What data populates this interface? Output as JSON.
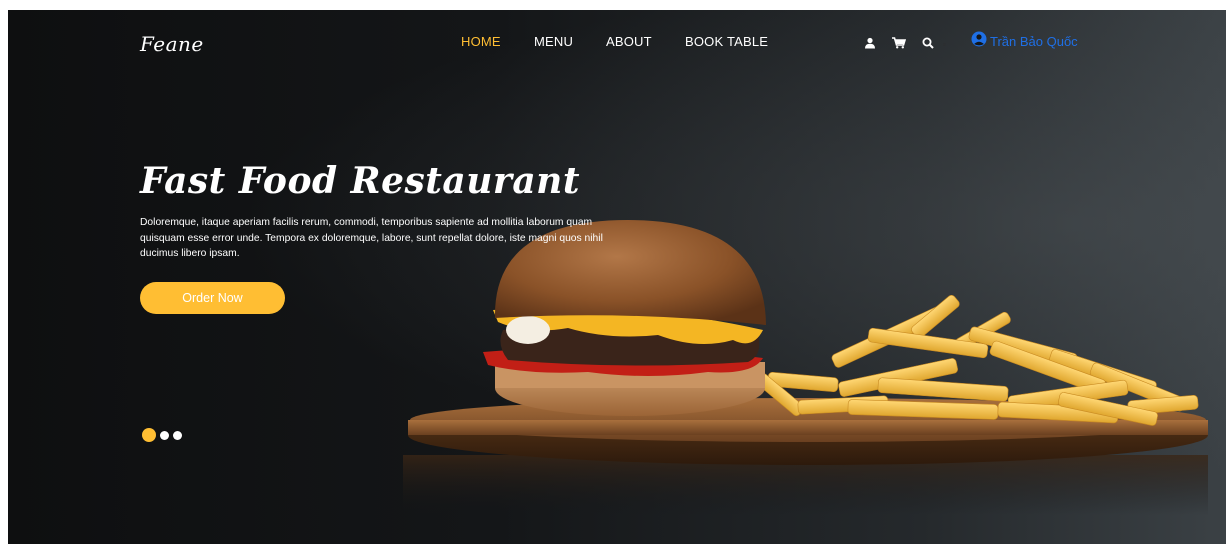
{
  "brand": {
    "logo": "Feane"
  },
  "nav": {
    "links": [
      {
        "label": "HOME",
        "active": true
      },
      {
        "label": "MENU",
        "active": false
      },
      {
        "label": "ABOUT",
        "active": false
      },
      {
        "label": "BOOK TABLE",
        "active": false
      }
    ],
    "icons": [
      "user-icon",
      "cart-icon",
      "search-icon"
    ],
    "user": {
      "name": "Trần Bảo Quốc",
      "icon": "user-circle-icon"
    }
  },
  "hero": {
    "title": "Fast Food Restaurant",
    "description": "Doloremque, itaque aperiam facilis rerum, commodi, temporibus sapiente ad mollitia laborum quam quisquam esse error unde. Tempora ex doloremque, labore, sunt repellat dolore, iste magni quos nihil ducimus libero ipsam.",
    "cta_label": "Order Now",
    "slides": {
      "count": 3,
      "active_index": 0
    }
  },
  "colors": {
    "accent": "#ffbe33",
    "user_link": "#1f6fe5",
    "background": "#141618"
  }
}
